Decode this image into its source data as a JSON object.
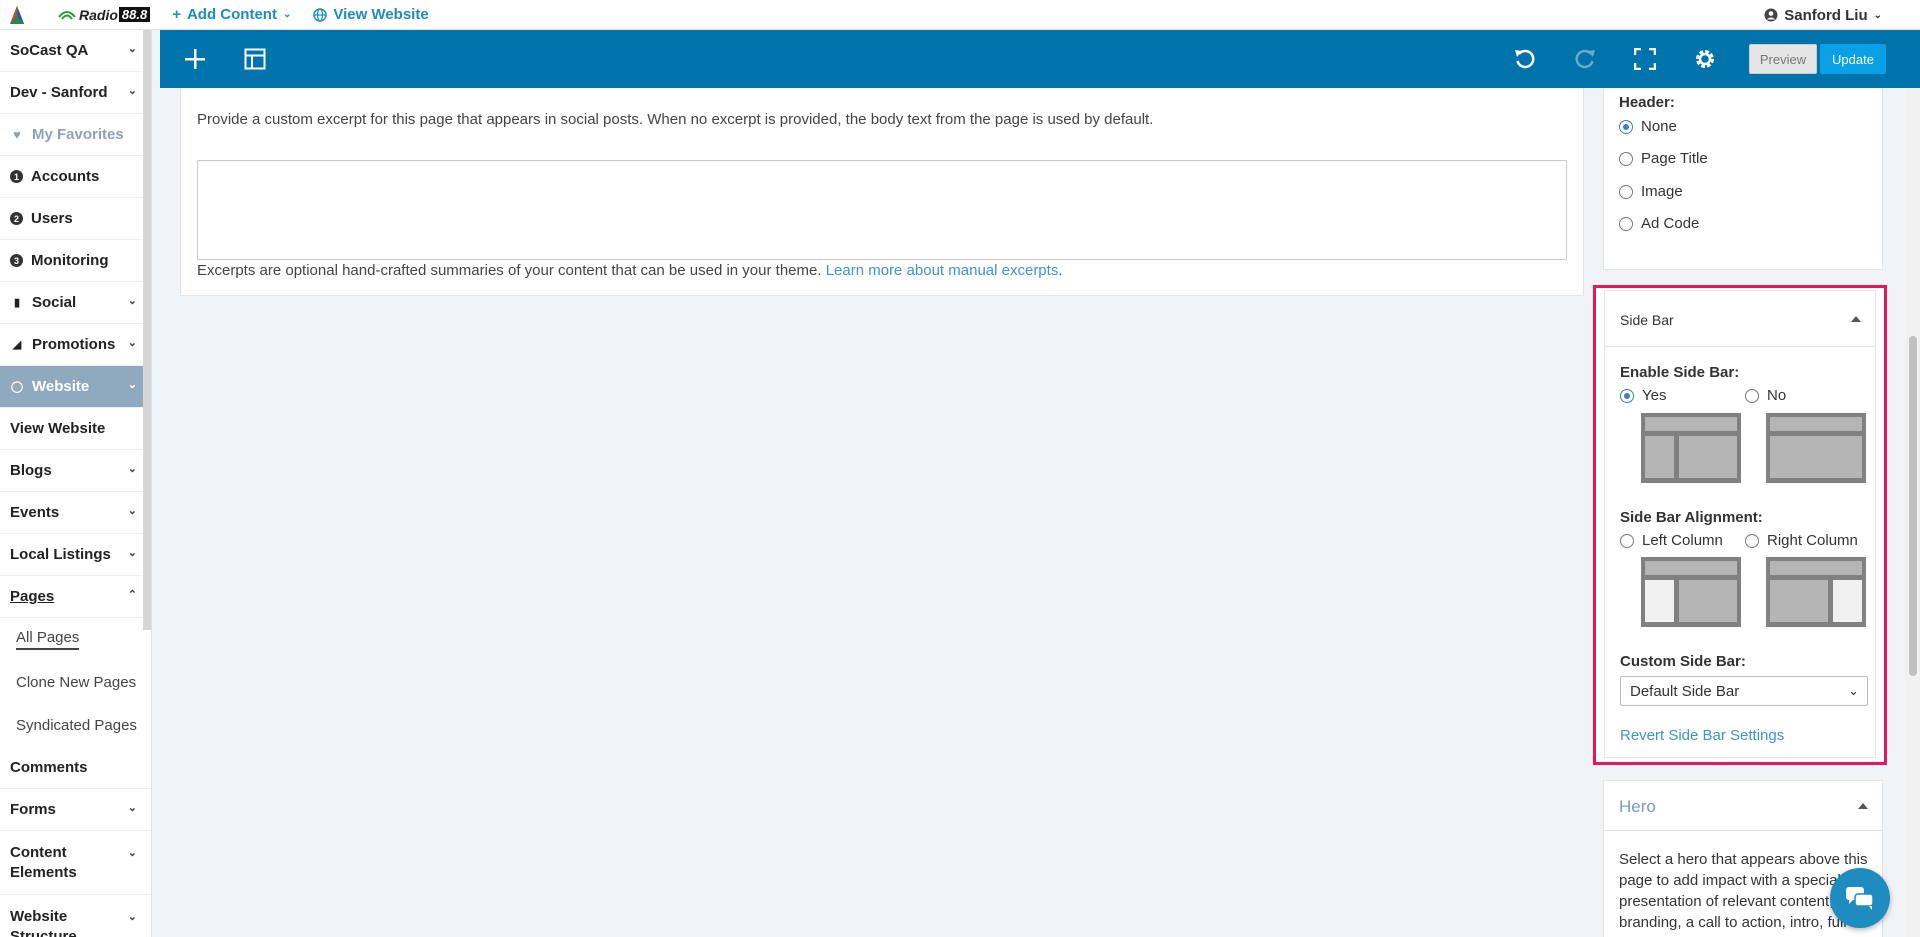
{
  "topbar": {
    "brand": "Radio",
    "brand_num": "88.8",
    "add_content": "Add Content",
    "view_website": "View Website",
    "user": "Sanford Liu"
  },
  "sidebar": {
    "org": "SoCast QA",
    "site": "Dev - Sanford",
    "favorites": "My Favorites",
    "accounts": "Accounts",
    "users": "Users",
    "monitoring": "Monitoring",
    "social": "Social",
    "promotions": "Promotions",
    "website": "Website",
    "view_website": "View Website",
    "blogs": "Blogs",
    "events": "Events",
    "local_listings": "Local Listings",
    "pages": "Pages",
    "all_pages": "All Pages",
    "clone_new_pages": "Clone New Pages",
    "syndicated_pages": "Syndicated Pages",
    "comments": "Comments",
    "forms": "Forms",
    "content_elements": "Content Elements",
    "website_structure": "Website Structure"
  },
  "toolbar": {
    "preview": "Preview",
    "update": "Update"
  },
  "excerpt": {
    "help": "Provide a custom excerpt for this page that appears in social posts. When no excerpt is provided, the body text from the page is used by default.",
    "footer": "Excerpts are optional hand-crafted summaries of your content that can be used in your theme.",
    "link": "Learn more about manual excerpts",
    "period": "."
  },
  "header_box": {
    "label": "Header:",
    "options": [
      "None",
      "Page Title",
      "Image",
      "Ad Code"
    ],
    "selected": "None"
  },
  "sidebar_box": {
    "title": "Side Bar",
    "enable_label": "Enable Side Bar:",
    "yes": "Yes",
    "no": "No",
    "alignment_label": "Side Bar Alignment:",
    "left_column": "Left Column",
    "right_column": "Right Column",
    "custom_label": "Custom Side Bar:",
    "custom_value": "Default Side Bar",
    "revert": "Revert Side Bar Settings"
  },
  "hero_box": {
    "title": "Hero",
    "text": "Select a hero that appears above this page to add impact with a special presentation of relevant content, branding, a call to action, intro, full"
  },
  "colors": {
    "toolbar": "#0073aa",
    "accent": "#1e8cbe",
    "highlight": "#e8175d",
    "sidebar_active": "#8fa9bf"
  }
}
